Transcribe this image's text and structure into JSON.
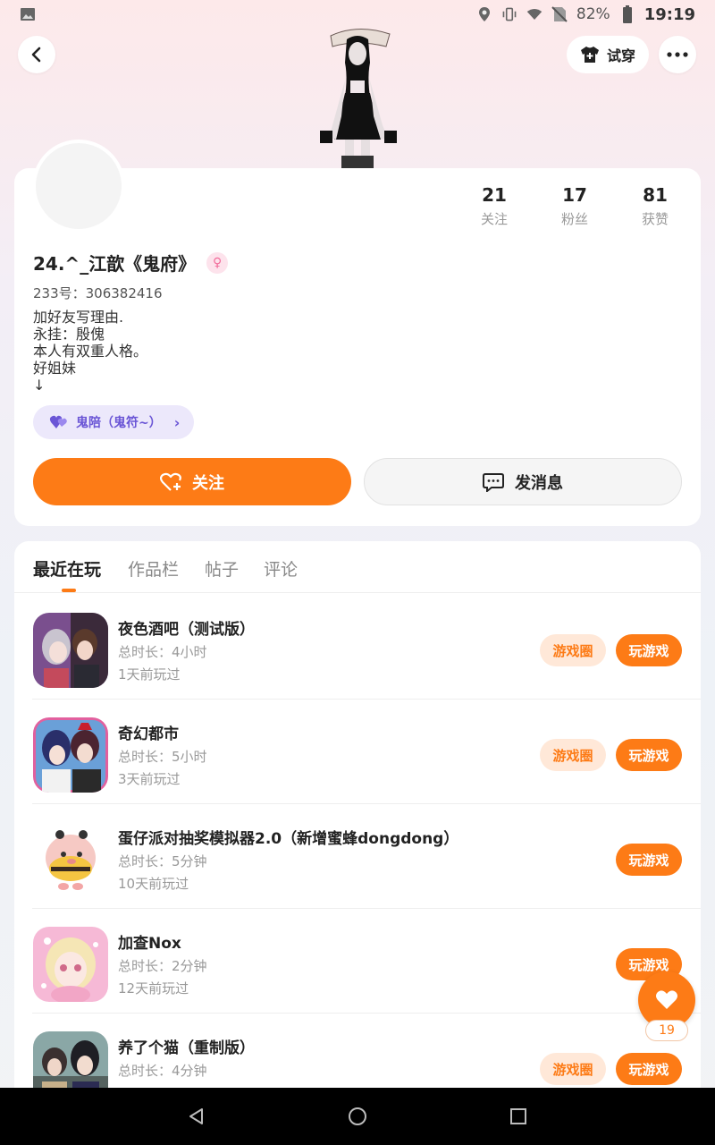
{
  "status_bar": {
    "battery": "82%",
    "time": "19:19"
  },
  "header": {
    "tryon_label": "试穿"
  },
  "profile": {
    "username": "24.^_江歆《鬼府》",
    "uid": "233号：306382416",
    "bio_lines": [
      "加好友写理由.",
      "永挂：殷傀",
      "本人有双重人格。",
      "好姐妹",
      "↓"
    ],
    "companion_label": "鬼陪（鬼符~）",
    "stats": [
      {
        "num": "21",
        "label": "关注"
      },
      {
        "num": "17",
        "label": "粉丝"
      },
      {
        "num": "81",
        "label": "获赞"
      }
    ],
    "follow_label": "关注",
    "message_label": "发消息"
  },
  "tabs": [
    "最近在玩",
    "作品栏",
    "帖子",
    "评论"
  ],
  "games": [
    {
      "title": "夜色酒吧（测试版）",
      "duration": "总时长：4小时",
      "last_played": "1天前玩过",
      "has_circle": true
    },
    {
      "title": "奇幻都市",
      "duration": "总时长：5小时",
      "last_played": "3天前玩过",
      "has_circle": true
    },
    {
      "title": "蛋仔派对抽奖模拟器2.0（新增蜜蜂dongdong）",
      "duration": "总时长：5分钟",
      "last_played": "10天前玩过",
      "has_circle": false
    },
    {
      "title": "加查Nox",
      "duration": "总时长：2分钟",
      "last_played": "12天前玩过",
      "has_circle": false
    },
    {
      "title": "养了个猫（重制版）",
      "duration": "总时长：4分钟",
      "last_played": "",
      "has_circle": true
    }
  ],
  "buttons": {
    "circle_label": "游戏圈",
    "play_label": "玩游戏"
  },
  "like_count": "19",
  "colors": {
    "accent": "#fd7b16",
    "companion": "#6b56d6"
  }
}
